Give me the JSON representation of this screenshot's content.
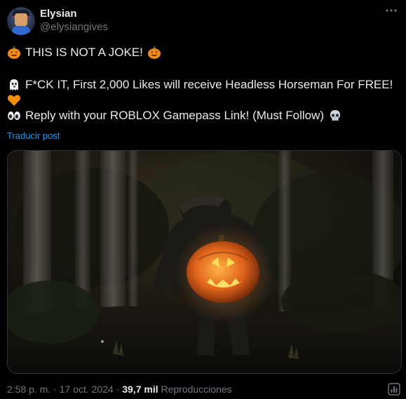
{
  "author": {
    "name": "Elysian",
    "handle": "@elysiangives"
  },
  "tweet": {
    "line1": "THIS IS NOT A JOKE!",
    "line2": "F*CK IT, First 2,000 Likes will receive Headless Horseman For FREE!",
    "line3": "Reply with your ROBLOX Gamepass Link! (Must Follow)",
    "translate_label": "Traducir post"
  },
  "icons": {
    "menu": "more-icon",
    "pumpkin": "jack-o-lantern-icon",
    "ghost": "ghost-icon",
    "heart": "orange-heart-icon",
    "eyes": "eyes-icon",
    "skull": "skull-icon",
    "analytics": "analytics-icon"
  },
  "meta": {
    "time": "2:58 p. m.",
    "sep1": "·",
    "date": "17 oct. 2024",
    "sep2": "·",
    "views_count": "39,7 mil",
    "views_label": "Reproducciones"
  },
  "colors": {
    "background": "#000000",
    "text": "#e7e9ea",
    "muted": "#71767b",
    "link": "#1d9bf0"
  }
}
